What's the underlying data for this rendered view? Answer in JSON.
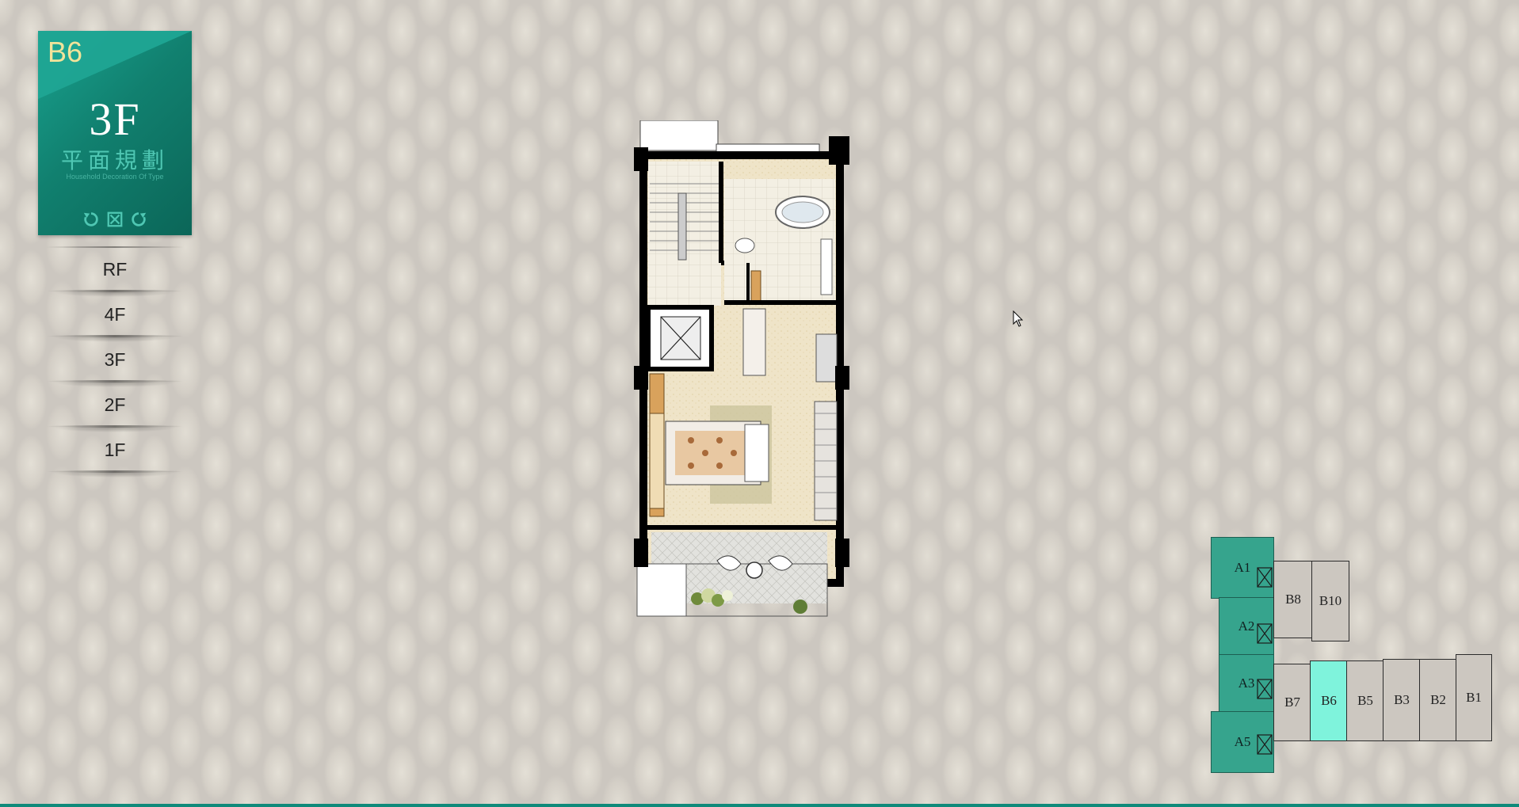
{
  "unit_panel": {
    "unit_code": "B6",
    "floor": "3F",
    "plan_title": "平面規劃",
    "plan_subtitle": "Household Decoration Of Type",
    "tools": [
      {
        "name": "rotate-left-icon"
      },
      {
        "name": "fullscreen-icon"
      },
      {
        "name": "rotate-right-icon"
      }
    ]
  },
  "floors": [
    "RF",
    "4F",
    "3F",
    "2F",
    "1F"
  ],
  "selected_floor": "3F",
  "site_map": {
    "a_units": [
      "A1",
      "A2",
      "A3",
      "A5"
    ],
    "b_units_top": [
      "B8",
      "B10"
    ],
    "b_units_bottom": [
      "B7",
      "B6",
      "B5",
      "B3",
      "B2",
      "B1"
    ],
    "selected_unit": "B6",
    "colors": {
      "a_units": "#36a48d",
      "selected": "#7ff3dc"
    }
  },
  "colors": {
    "accent": "#11806f",
    "unit_code": "#f2e39a"
  }
}
